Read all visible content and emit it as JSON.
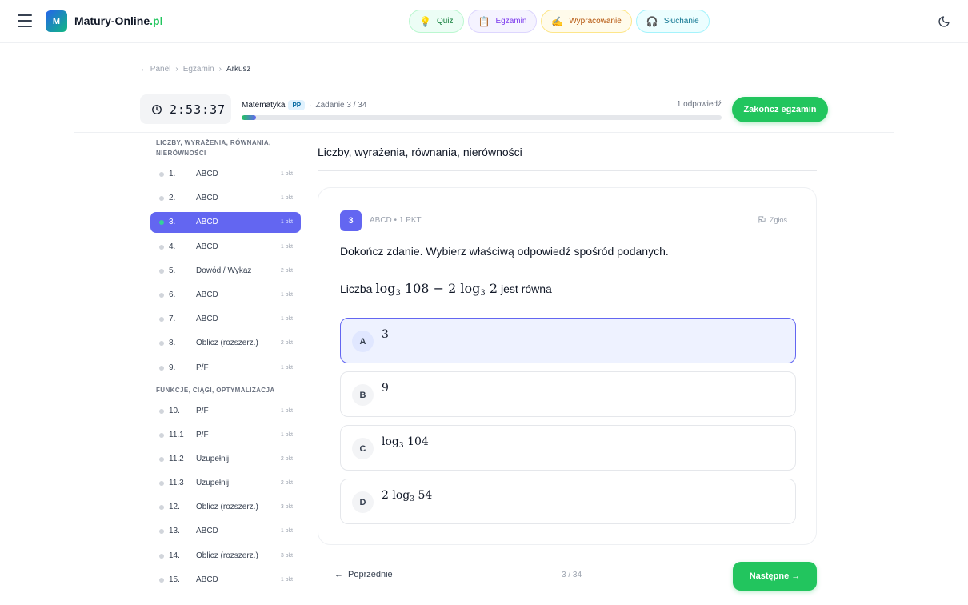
{
  "brand": {
    "logo_letter": "M",
    "name": "Matury-Online",
    "tld": ".pl"
  },
  "nav_pills": [
    {
      "icon": "💡",
      "label": "Quiz"
    },
    {
      "icon": "📋",
      "label": "Egzamin"
    },
    {
      "icon": "✍",
      "label": "Wypracowanie"
    },
    {
      "icon": "🎧",
      "label": "Słuchanie"
    }
  ],
  "breadcrumb": {
    "back": "← Panel",
    "sep": "›",
    "item1": "Egzamin",
    "current": "Arkusz"
  },
  "exam": {
    "timer": "2:53:37",
    "subject": "Matematyka",
    "level": "PP",
    "task_progress": "Zadanie 3 / 34",
    "answered": "1 odpowiedź",
    "progress_fraction": 0.03,
    "finish_label": "Zakończ egzamin"
  },
  "sidebar": {
    "sections": [
      {
        "title": "LICZBY, WYRAŻENIA, RÓWNANIA, NIERÓWNOŚCI",
        "tasks": [
          {
            "num": "1.",
            "type": "ABCD",
            "pts": "1 pkt"
          },
          {
            "num": "2.",
            "type": "ABCD",
            "pts": "1 pkt"
          },
          {
            "num": "3.",
            "type": "ABCD",
            "pts": "1 pkt",
            "active": true
          },
          {
            "num": "4.",
            "type": "ABCD",
            "pts": "1 pkt"
          },
          {
            "num": "5.",
            "type": "Dowód / Wykaz",
            "pts": "2 pkt"
          },
          {
            "num": "6.",
            "type": "ABCD",
            "pts": "1 pkt"
          },
          {
            "num": "7.",
            "type": "ABCD",
            "pts": "1 pkt"
          },
          {
            "num": "8.",
            "type": "Oblicz (rozszerz.)",
            "pts": "2 pkt"
          },
          {
            "num": "9.",
            "type": "P/F",
            "pts": "1 pkt"
          }
        ]
      },
      {
        "title": "FUNKCJE, CIĄGI, OPTYMALIZACJA",
        "tasks": [
          {
            "num": "10.",
            "type": "P/F",
            "pts": "1 pkt"
          },
          {
            "num": "11.1",
            "type": "P/F",
            "pts": "1 pkt"
          },
          {
            "num": "11.2",
            "type": "Uzupełnij",
            "pts": "2 pkt"
          },
          {
            "num": "11.3",
            "type": "Uzupełnij",
            "pts": "2 pkt"
          },
          {
            "num": "12.",
            "type": "Oblicz (rozszerz.)",
            "pts": "3 pkt"
          },
          {
            "num": "13.",
            "type": "ABCD",
            "pts": "1 pkt"
          },
          {
            "num": "14.",
            "type": "Oblicz (rozszerz.)",
            "pts": "3 pkt"
          },
          {
            "num": "15.",
            "type": "ABCD",
            "pts": "1 pkt"
          }
        ]
      }
    ]
  },
  "main": {
    "section_title": "Liczby, wyrażenia, równania, nierówności",
    "question": {
      "number": "3",
      "meta": "ABCD • 1 PKT",
      "report_label": "Zgłoś",
      "instruction": "Dokończ zdanie. Wybierz właściwą odpowiedź spośród podanych.",
      "formula_prefix": "Liczba",
      "formula_suffix": "jest równa",
      "formula_parts": {
        "log": "log",
        "base": "3",
        "a": "108",
        "minus": "−",
        "coef": "2",
        "b": "2"
      },
      "options": [
        {
          "letter": "A",
          "text": "3",
          "selected": true
        },
        {
          "letter": "B",
          "text": "9"
        },
        {
          "letter": "C",
          "log": "log",
          "base": "3",
          "arg": "104"
        },
        {
          "letter": "D",
          "coef": "2",
          "log": "log",
          "base": "3",
          "arg": "54"
        }
      ]
    }
  },
  "footer": {
    "prev_label": "Poprzednie",
    "prev_arrow": "←",
    "counter": "3 / 34",
    "next_label": "Następne →"
  }
}
